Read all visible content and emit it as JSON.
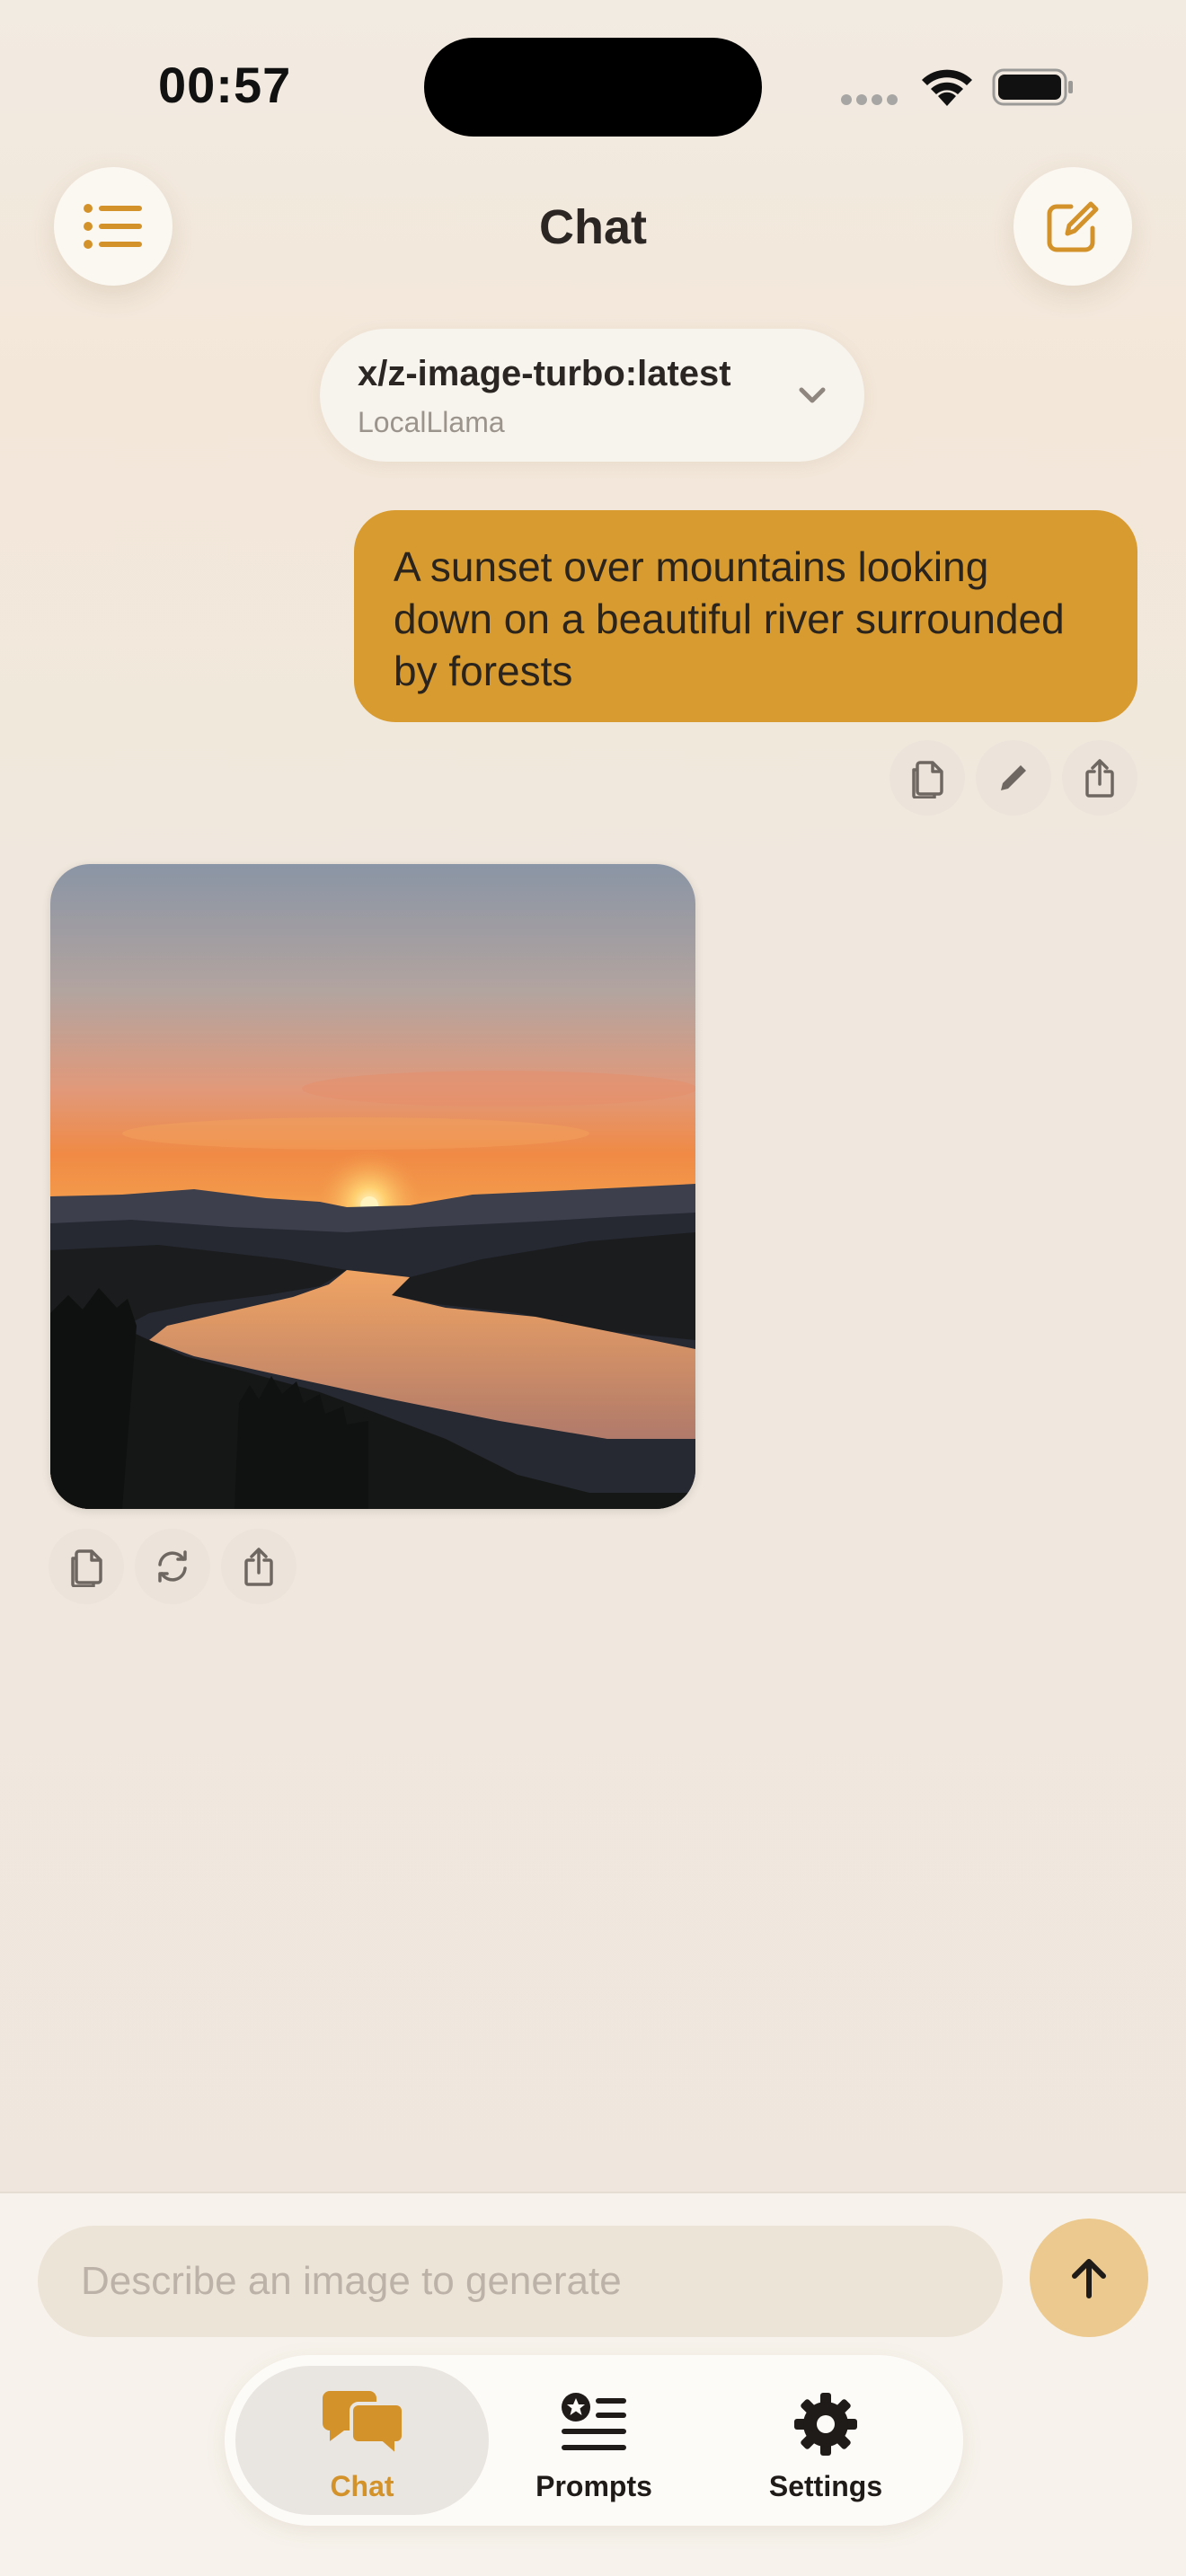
{
  "status_bar": {
    "time": "00:57"
  },
  "header": {
    "title": "Chat",
    "menu_icon": "list-icon",
    "compose_icon": "compose-icon"
  },
  "model_selector": {
    "model": "x/z-image-turbo:latest",
    "provider": "LocalLlama"
  },
  "messages": {
    "user_prompt": "A sunset over mountains looking down on a beautiful river surrounded by forests",
    "user_actions": [
      "copy-icon",
      "edit-icon",
      "share-icon"
    ],
    "image_actions": [
      "copy-icon",
      "regenerate-icon",
      "share-icon"
    ]
  },
  "composer": {
    "placeholder": "Describe an image to generate"
  },
  "tabs": [
    {
      "label": "Chat",
      "icon": "chat-bubbles-icon",
      "active": true
    },
    {
      "label": "Prompts",
      "icon": "prompts-list-icon",
      "active": false
    },
    {
      "label": "Settings",
      "icon": "gear-icon",
      "active": false
    }
  ],
  "colors": {
    "accent": "#d89b30",
    "tab_active": "#d4922a",
    "send_button": "#ecc98e",
    "background": "#f0e8de"
  }
}
